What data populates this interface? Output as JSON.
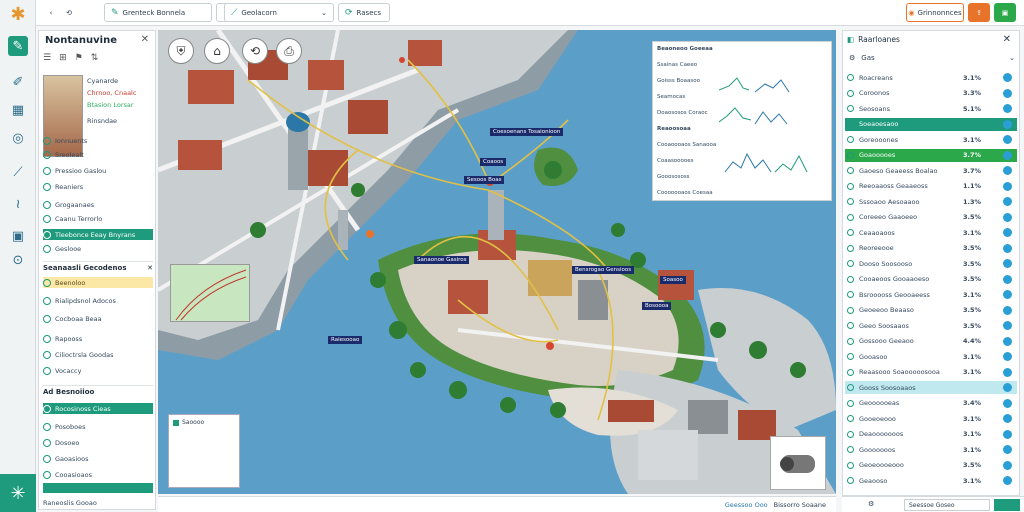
{
  "rail": {
    "icons": [
      "logo-icon",
      "tools-icon",
      "pencil-icon",
      "grid-icon",
      "info-icon",
      "brush-icon",
      "route-icon",
      "book-icon",
      "clock-icon",
      "snowflake-icon"
    ]
  },
  "toolbar": {
    "tab1": "Grenteck Bonnela",
    "tab2": "Geolacorn",
    "tab3": "Rasecs",
    "btn_right1": "Grinnonnces",
    "accent": "#1e9a7c",
    "orange": "#e8742c",
    "green": "#2aa84a"
  },
  "left_panel": {
    "title": "Nontanuvine",
    "info_lines": [
      "Cyanarde",
      "Chrnoo, Cnaalc",
      "Btasion Lorsar",
      "Rinsndae"
    ],
    "group1": [
      "Ionnuents",
      "Sreolealt",
      "Pressioo Gaslou",
      "Reaniers"
    ],
    "group2": [
      "Grogaanaes",
      "Caanu Terrorlo",
      "Tleebonce Eeay Bnyrans",
      "Geslooe"
    ],
    "section1": "Seanaasli Gecodenos",
    "group3": [
      "Beenoloo",
      "Rialipdsnol Adocos",
      "Cocboaa Beaa",
      "Rapooss",
      "Cilioctrsla Goodas",
      "Vocaccy"
    ],
    "section2": "Ad  Besnoiioo",
    "group4": [
      "Rocosinoss Cieas",
      "Posoboes",
      "Dosoeo",
      "Gaoasioos",
      "Cooasioaos"
    ],
    "footer": "Raneoslis Gooao"
  },
  "map": {
    "labels": [
      "Coesoenans Tosaionioon",
      "Coaoos",
      "Sesoos Boas",
      "Sanaonoe Gasiros",
      "Bensrogao Gensioos",
      "Raiesooao",
      "Soasoo",
      "Bosoooa"
    ],
    "stats_title": "Beaoneoo Goeeaa",
    "stats_rows": [
      "Ssainas Caeeo",
      "Goisss Boaasoo",
      "Seamocas",
      "Doaososos Coraoc"
    ],
    "stats_title2": "Reaoosoaa",
    "stats_rows2": [
      "Cooaoooaos Sanaooa",
      "Coaasooooes",
      "Gooosososs",
      "Cooooooaos Coesaa"
    ],
    "mini_card_label": "Saoooo"
  },
  "status": {
    "left": "Geessoo  Ooo",
    "right": "Bissorro Soaane"
  },
  "right_panel": {
    "title": "Raarloanes",
    "filter": "Gas",
    "rows": [
      {
        "name": "Roacreans",
        "value": "3.1%"
      },
      {
        "name": "Coroonos",
        "value": "3.3%"
      },
      {
        "name": "Seosoans",
        "value": "5.1%"
      },
      {
        "name": "Soeaoesaoo",
        "value": ""
      },
      {
        "name": "Goreooones",
        "value": "3.1%"
      },
      {
        "name": "Goaooooes",
        "value": "3.7%"
      },
      {
        "name": "Gaoeso Geaeess Boalao",
        "value": "3.7%"
      },
      {
        "name": "Reeoaaoss Geaaeoss",
        "value": "1.1%"
      },
      {
        "name": "Sssoaoo Aesoaaoo",
        "value": "1.3%"
      },
      {
        "name": "Coreeeo Gaaoeeo",
        "value": "3.5%"
      },
      {
        "name": "Ceaaoaoos",
        "value": "3.1%"
      },
      {
        "name": "Reoreeooe",
        "value": "3.5%"
      },
      {
        "name": "Dooso Soosooso",
        "value": "3.5%"
      },
      {
        "name": "Cooaeoos Gooaaoeso",
        "value": "3.5%"
      },
      {
        "name": "Bsrooooss Geooaeess",
        "value": "3.1%"
      },
      {
        "name": "Geoeeoo Beaaso",
        "value": "3.5%"
      },
      {
        "name": "Geeo Soosaaos",
        "value": "3.5%"
      },
      {
        "name": "Gossooo Geeaoo",
        "value": "4.4%"
      },
      {
        "name": "Gooasoo",
        "value": "3.1%"
      },
      {
        "name": "Reaasooo Soaooooosooa",
        "value": "3.1%"
      },
      {
        "name": "Gooss Soosoaaos",
        "value": ""
      },
      {
        "name": "Geoooooeas",
        "value": "3.4%"
      },
      {
        "name": "Gooeoeooo",
        "value": "3.1%"
      },
      {
        "name": "Deaooooooos",
        "value": "3.1%"
      },
      {
        "name": "Gooooooos",
        "value": "3.1%"
      },
      {
        "name": "Geoeoooeooo",
        "value": "3.5%"
      },
      {
        "name": "Geaooso",
        "value": "3.1%"
      }
    ],
    "bottom_btn": "Seessoe Goseo"
  }
}
